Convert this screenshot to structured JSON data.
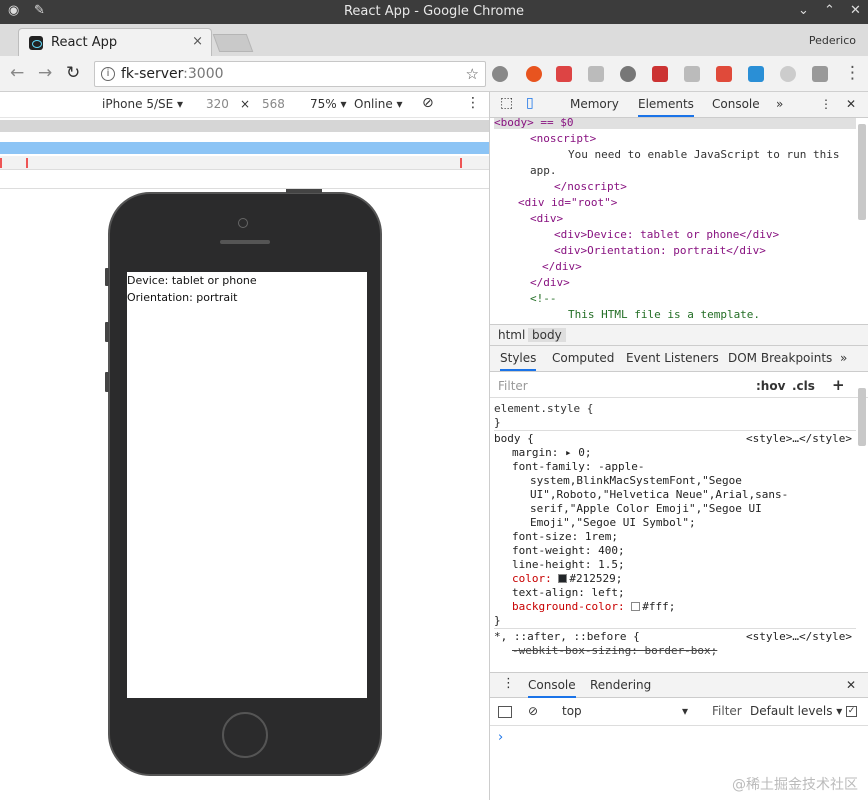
{
  "window": {
    "title": "React App - Google Chrome",
    "profile": "Pederico"
  },
  "tab": {
    "label": "React App",
    "close": "×"
  },
  "address": {
    "host": "fk-server",
    "port": ":3000"
  },
  "device_toolbar": {
    "device": "iPhone 5/SE ▾",
    "width": "320",
    "times": "×",
    "height": "568",
    "zoom": "75% ▾",
    "network": "Online ▾"
  },
  "page": {
    "line1": "Device: tablet or phone",
    "line2": "Orientation: portrait"
  },
  "devtools": {
    "tabs": [
      "Memory",
      "Elements",
      "Console",
      "»"
    ],
    "elements_lines": [
      "<body> == $0",
      "<noscript>",
      "You need to enable JavaScript to run this",
      "app.",
      "</noscript>",
      "<div id=\"root\">",
      "<div>",
      "<div>Device: tablet or phone</div>",
      "<div>Orientation: portrait</div>",
      "</div>",
      "</div>",
      "<!--",
      "This HTML file is a template."
    ],
    "crumbs": [
      "html",
      "body"
    ],
    "subtabs": [
      "Styles",
      "Computed",
      "Event Listeners",
      "DOM Breakpoints",
      "»"
    ],
    "filter_placeholder": "Filter",
    "hov": ":hov",
    "cls": ".cls",
    "plus": "+",
    "styles": {
      "element_style": "element.style {",
      "close": "}",
      "body_sel": "body {",
      "source": "<style>…</style>",
      "margin": "margin: ▸ 0;",
      "ff1": "font-family: -apple-",
      "ff2": "system,BlinkMacSystemFont,\"Segoe",
      "ff3": "UI\",Roboto,\"Helvetica Neue\",Arial,sans-",
      "ff4": "serif,\"Apple Color Emoji\",\"Segoe UI",
      "ff5": "Emoji\",\"Segoe UI Symbol\";",
      "fs": "font-size: 1rem;",
      "fw": "font-weight: 400;",
      "lh": "line-height: 1.5;",
      "color": "color:",
      "color_val": "#212529;",
      "ta": "text-align: left;",
      "bg": "background-color:",
      "bg_val": "#fff;",
      "universal": "*, ::after, ::before {",
      "webkit": "-webkit-box-sizing: border-box;"
    },
    "console_tabs": [
      "Console",
      "Rendering"
    ],
    "context": "top",
    "console_filter": "Filter",
    "levels": "Default levels ▾",
    "prompt": "›"
  },
  "watermark": "@稀土掘金技术社区",
  "colors": {
    "text_color": "#212529",
    "bg_color": "#fff",
    "tag": "#881280",
    "accent": "#1a73e8"
  }
}
